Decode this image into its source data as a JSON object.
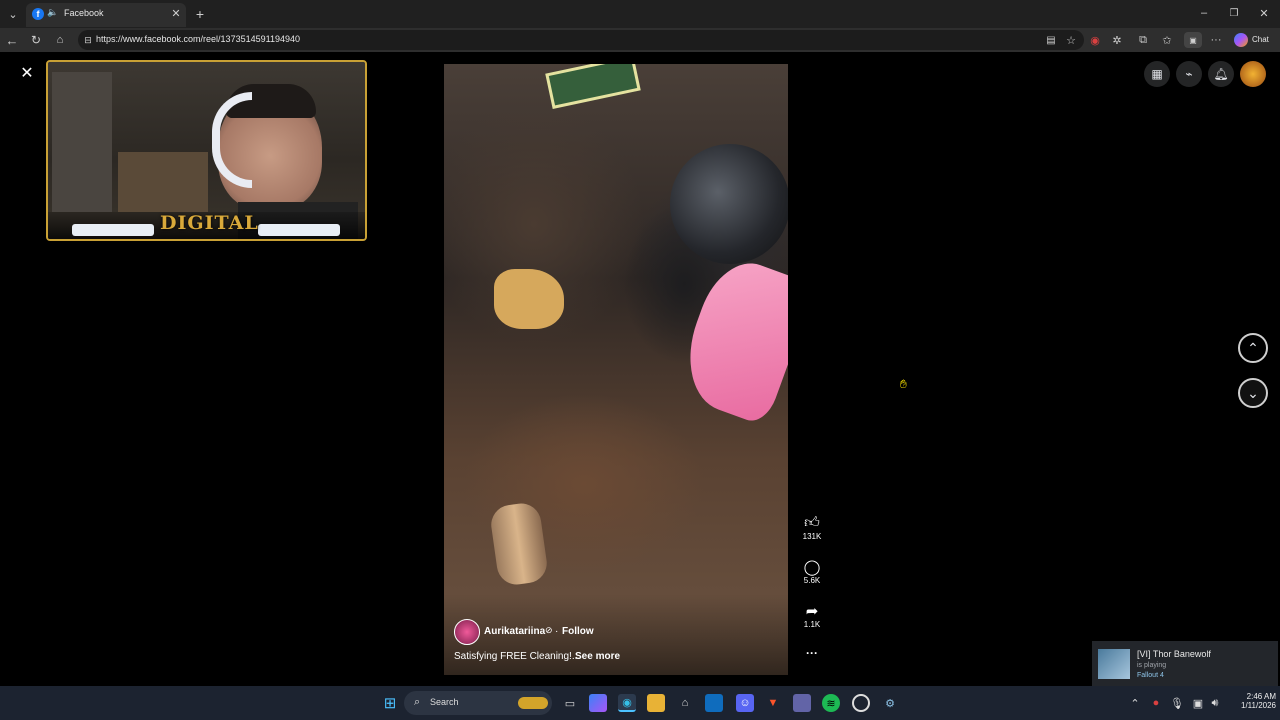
{
  "browser": {
    "tab_title": "Facebook",
    "url": "https://www.facebook.com/reel/1373514591194940",
    "chat_label": "Chat"
  },
  "overlay": {
    "webcam_banner_text": "DIGITAL"
  },
  "reel": {
    "author": "Aurikatariina",
    "separator": "·",
    "follow_label": "Follow",
    "caption": "Satisfying FREE Cleaning!...",
    "see_more": "See more",
    "likes": "131K",
    "comments": "5.6K",
    "shares": "1.1K",
    "more_label": "···"
  },
  "notification": {
    "title": "[VI] Thor Banewolf",
    "subtitle": "is playing",
    "game": "Fallout 4"
  },
  "taskbar": {
    "search_label": "Search",
    "time": "2:46 AM",
    "date": "1/11/2026"
  },
  "colors": {
    "accent_gold": "#c9a135",
    "steam_blue": "#8ec4e8"
  }
}
